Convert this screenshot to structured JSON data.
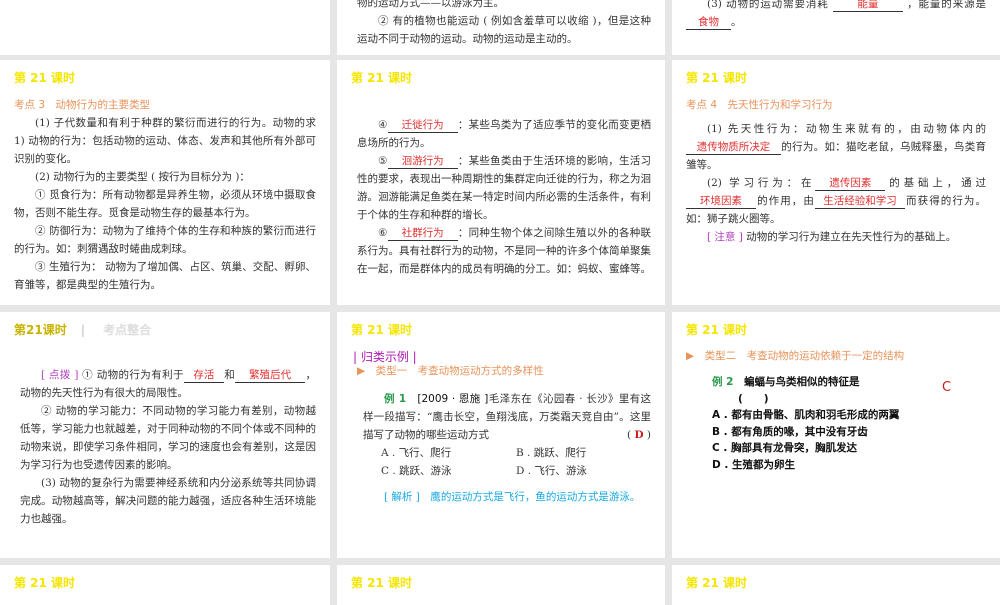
{
  "slide_header": "第 21 课时",
  "top": {
    "mid": {
      "line1": "物的运动方式——以游泳为主。",
      "line2": "② 有的植物也能运动 ( 例如含羞草可以收缩 )，但是这种运动不同于动物的运动。动物的运动是主动的。"
    },
    "right": {
      "pre": "(3) 动物的运动需要消耗",
      "ans1": "能量",
      "mid": "，能量的来源是",
      "ans2": "食物",
      "end": "。"
    }
  },
  "s1": {
    "kaodian": "考点 3　动物行为的主要类型",
    "p1": "(1) 子代数量和有利于种群的繁衍而进行的行为。动物的求 1) 动物的行为：包括动物的运动、体态、发声和其他所有外部可识别的变化。",
    "p2": "(2) 动物行为的主要类型 ( 按行为目标分为 )：",
    "p3": "① 觅食行为：所有动物都是异养生物，必须从环境中摄取食物，否则不能生存。觅食是动物生存的最基本行为。",
    "p4": "② 防御行为：动物为了维持个体的生存和种族的繁衍而进行的行为。如：刺猬遇敌时蜷曲成刺球。",
    "p5": "③ 生殖行为： 动物为了增加偶、占区、筑巢、交配、孵卵、育雏等，都是典型的生殖行为。"
  },
  "s2": {
    "n4": "④",
    "a4": "迁徙行为",
    "t4": "：某些鸟类为了适应季节的变化而变更栖息场所的行为。",
    "n5": "⑤",
    "a5": "洄游行为",
    "t5": "：某些鱼类由于生活环境的影响，生活习性的要求，表现出一种周期性的集群定向迁徙的行为，称之为洄游。洄游能满足鱼类在某一特定时间内所必需的生活条件，有利于个体的生存和种群的增长。",
    "n6": "⑥",
    "a6": "社群行为",
    "t6": "：同种生物个体之间除生殖以外的各种联系行为。具有社群行为的动物，不是同一种的许多个体简单聚集在一起，而是群体内的成员有明确的分工。如：蚂蚁、蜜蜂等。"
  },
  "s3": {
    "kaodian": "考点 4　先天性行为和学习行为",
    "p1a": "(1) 先天性行为：动物生来就有的，由动物体内的",
    "a1": "遗传物质所决定",
    "p1b": "的行为。如：猫吃老鼠，乌贼释墨，鸟类育雏等。",
    "p2a": "(2) 学习行为：在",
    "a2": "遗传因素",
    "p2b": "的基础上，通过",
    "a3": "环境因素",
    "p2c": "的作用，由",
    "a4": "生活经验和学习",
    "p2d": "而获得的行为。如：狮子跳火圈等。",
    "note": "[ 注意 ]",
    "note_text": "动物的学习行为建立在先天性行为的基础上。"
  },
  "s4": {
    "header": "第21课时",
    "header_sub": "考点整合",
    "tag": "[ 点拨 ]",
    "p1a": "① 动物的行为有利于",
    "a1": "存活",
    "p1b": "和",
    "a2": "繁殖后代",
    "p1c": "，动物的先天性行为有很大的局限性。",
    "p2": "② 动物的学习能力：不同动物的学习能力有差别，动物越低等，学习能力也就越差，对于同种动物的不同个体或不同种的动物来说，即使学习条件相同，学习的速度也会有差别，这是因为学习行为也受遗传因素的影响。",
    "p3": "(3) 动物的复杂行为需要神经系统和内分泌系统等共同协调完成。动物越高等，解决问题的能力越强，适应各种生活环境能力也越强。"
  },
  "s5": {
    "section": "| 归类示例 |",
    "type": "▶　类型一　考查动物运动方式的多样性",
    "ex": "例 1",
    "src": "[2009 · 恩施 ]",
    "q": "毛泽东在《沁园春 · 长沙》里有这样一段描写：“鹰击长空，鱼翔浅底，万类霜天竞自由”。这里描写了动物的哪些运动方式",
    "answer": "D",
    "options": [
      "A . 飞行、爬行",
      "B . 跳跃、爬行",
      "C . 跳跃、游泳",
      "D . 飞行、游泳"
    ],
    "jx": "[ 解析 ]",
    "jx_text": "鹰的运动方式是飞行，鱼的运动方式是游泳。"
  },
  "s6": {
    "type": "▶　类型二　考查动物的运动依赖于一定的结构",
    "ex": "例 2",
    "q": "蝙蝠与鸟类相似的特征是",
    "paren": "(　　)",
    "answer": "C",
    "options": [
      "A . 都有由骨骼、肌肉和羽毛形成的两翼",
      "B . 都有角质的喙，其中没有牙齿",
      "C . 胸部具有龙骨突，胸肌发达",
      "D . 生殖都为卵生"
    ]
  }
}
